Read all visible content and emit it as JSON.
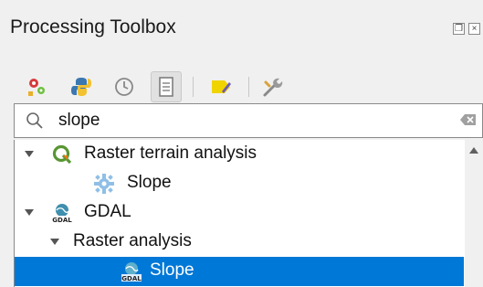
{
  "panel": {
    "title": "Processing Toolbox",
    "float_icon": "float-window-icon",
    "close_icon": "close-icon"
  },
  "toolbar": {
    "items": [
      {
        "name": "models-icon"
      },
      {
        "name": "python-scripts-icon"
      },
      {
        "name": "history-icon"
      },
      {
        "name": "results-viewer-icon",
        "active": true
      },
      {
        "name": "edit-features-in-place-icon"
      },
      {
        "name": "options-icon"
      }
    ]
  },
  "search": {
    "value": "slope",
    "icon": "search-icon",
    "clear_icon": "clear-search-icon"
  },
  "tree": {
    "nodes": [
      {
        "label": "Raster terrain analysis",
        "icon": "qgis-logo-icon",
        "expanded": true
      },
      {
        "label": "Slope",
        "icon": "algorithm-gear-icon"
      },
      {
        "label": "GDAL",
        "icon": "gdal-icon",
        "expanded": true
      },
      {
        "label": "Raster analysis",
        "expanded": true
      },
      {
        "label": "Slope",
        "icon": "gdal-algorithm-icon",
        "selected": true
      }
    ]
  },
  "colors": {
    "selection": "#0078d7",
    "background": "#f0f0f0"
  }
}
